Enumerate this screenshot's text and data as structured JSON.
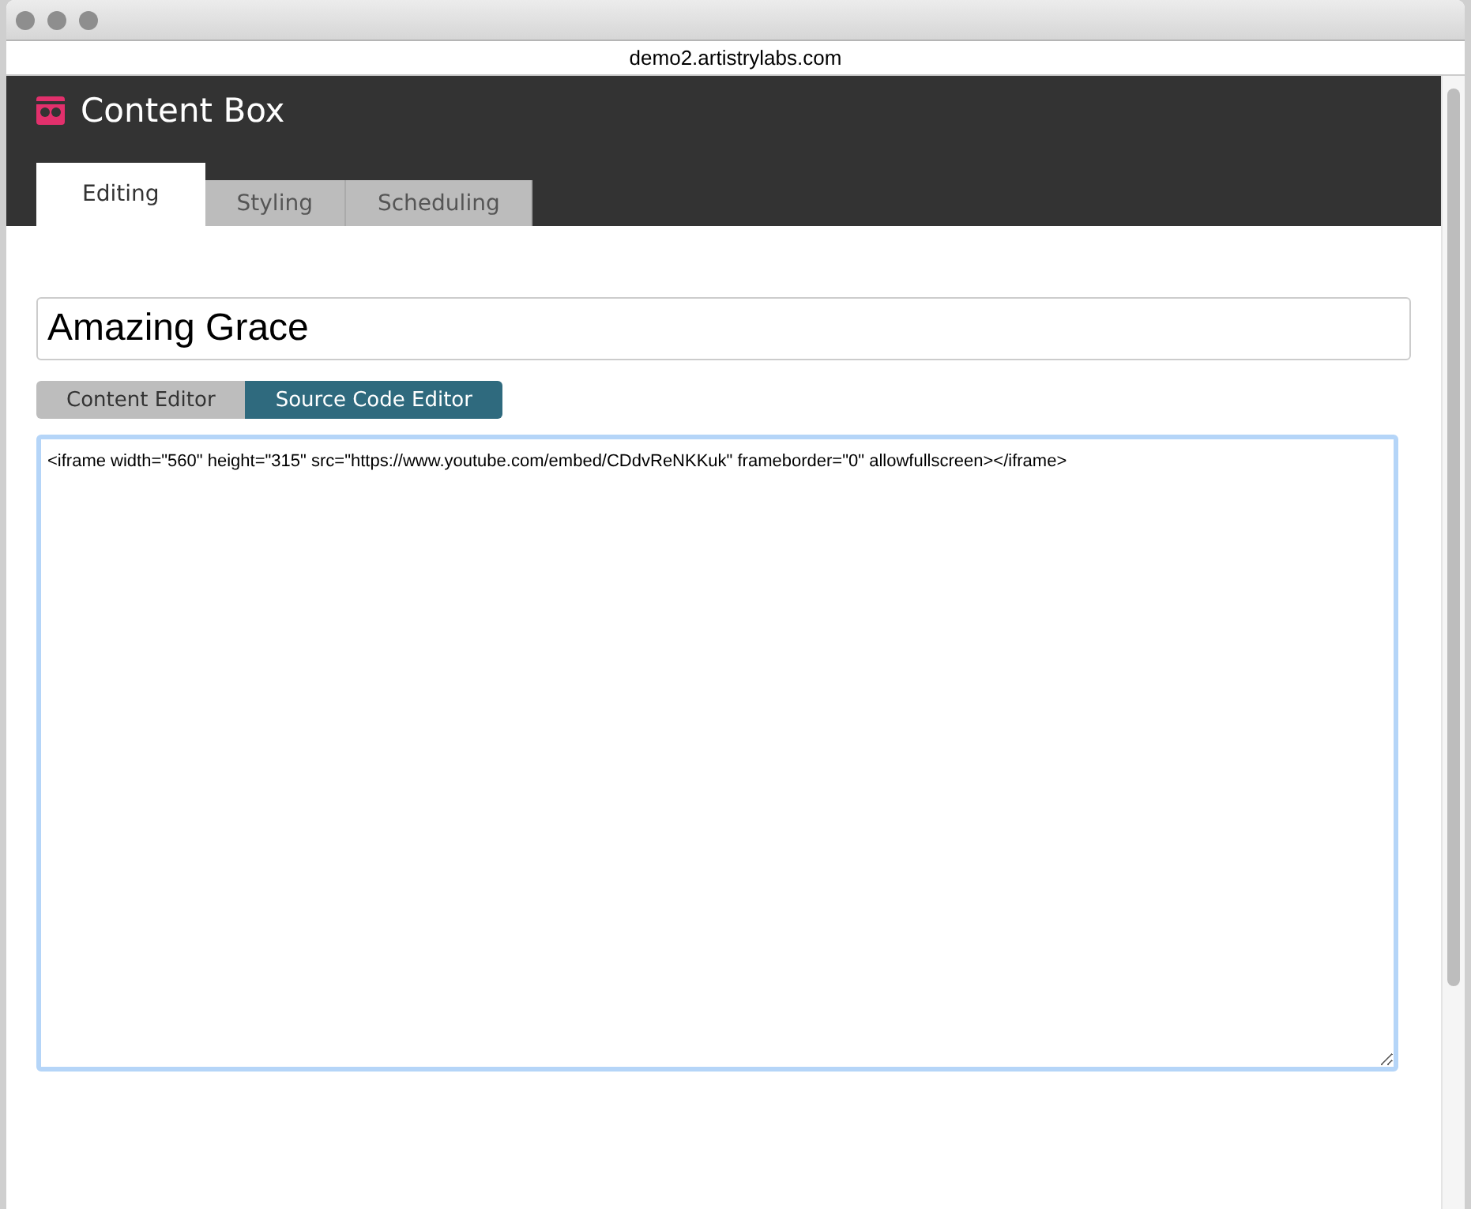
{
  "window": {
    "url": "demo2.artistrylabs.com"
  },
  "app": {
    "title": "Content Box"
  },
  "tabs": [
    {
      "label": "Editing",
      "selected": true
    },
    {
      "label": "Styling",
      "selected": false
    },
    {
      "label": "Scheduling",
      "selected": false
    }
  ],
  "title_field": {
    "value": "Amazing Grace"
  },
  "editor_modes": [
    {
      "label": "Content Editor",
      "selected": false
    },
    {
      "label": "Source Code Editor",
      "selected": true
    }
  ],
  "source_code": {
    "value": "<iframe width=\"560\" height=\"315\" src=\"https://www.youtube.com/embed/CDdvReNKKuk\" frameborder=\"0\" allowfullscreen></iframe>"
  }
}
